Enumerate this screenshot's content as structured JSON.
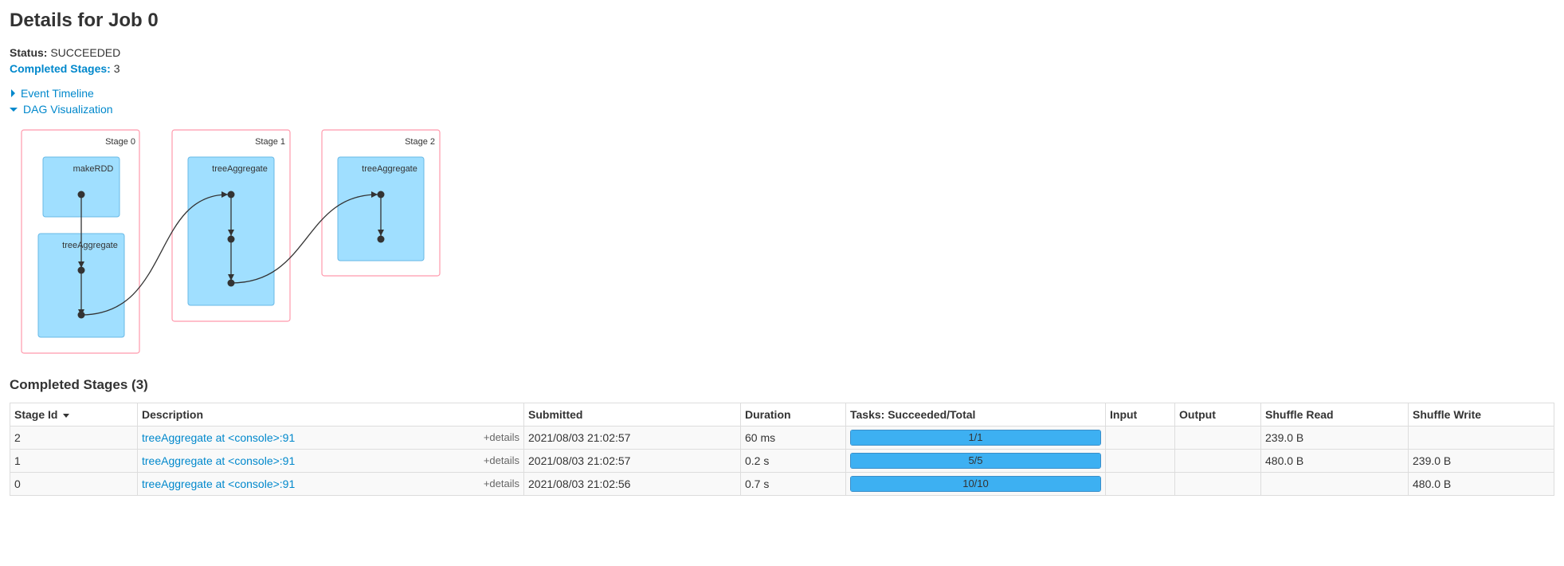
{
  "page": {
    "title": "Details for Job 0"
  },
  "summary": {
    "status_label": "Status:",
    "status_value": "SUCCEEDED",
    "completed_label": "Completed Stages:",
    "completed_value": "3"
  },
  "toggles": {
    "event_timeline": "Event Timeline",
    "dag_visualization": "DAG Visualization"
  },
  "dag": {
    "stages": [
      {
        "label": "Stage 0",
        "clusters": [
          "makeRDD",
          "treeAggregate"
        ]
      },
      {
        "label": "Stage 1",
        "clusters": [
          "treeAggregate"
        ]
      },
      {
        "label": "Stage 2",
        "clusters": [
          "treeAggregate"
        ]
      }
    ]
  },
  "section": {
    "title": "Completed Stages (3)"
  },
  "table": {
    "headers": {
      "stage_id": "Stage Id",
      "description": "Description",
      "submitted": "Submitted",
      "duration": "Duration",
      "tasks": "Tasks: Succeeded/Total",
      "input": "Input",
      "output": "Output",
      "shuffle_read": "Shuffle Read",
      "shuffle_write": "Shuffle Write"
    },
    "details_label": "+details",
    "rows": [
      {
        "stage_id": "2",
        "description": "treeAggregate at <console>:91",
        "submitted": "2021/08/03 21:02:57",
        "duration": "60 ms",
        "tasks": "1/1",
        "tasks_fraction": 1.0,
        "input": "",
        "output": "",
        "shuffle_read": "239.0 B",
        "shuffle_write": ""
      },
      {
        "stage_id": "1",
        "description": "treeAggregate at <console>:91",
        "submitted": "2021/08/03 21:02:57",
        "duration": "0.2 s",
        "tasks": "5/5",
        "tasks_fraction": 1.0,
        "input": "",
        "output": "",
        "shuffle_read": "480.0 B",
        "shuffle_write": "239.0 B"
      },
      {
        "stage_id": "0",
        "description": "treeAggregate at <console>:91",
        "submitted": "2021/08/03 21:02:56",
        "duration": "0.7 s",
        "tasks": "10/10",
        "tasks_fraction": 1.0,
        "input": "",
        "output": "",
        "shuffle_read": "",
        "shuffle_write": "480.0 B"
      }
    ]
  },
  "colors": {
    "link": "#0088cc",
    "stage_border": "#ff99ac",
    "cluster_fill": "#a0dfff",
    "progress_fill": "#3db0f2"
  }
}
